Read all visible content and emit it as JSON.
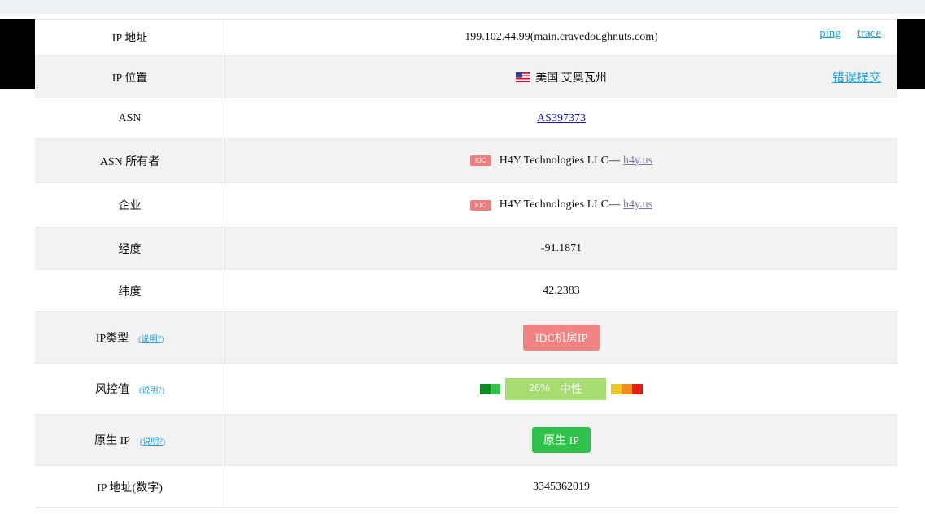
{
  "rows": [
    {
      "label": "IP 地址",
      "value": "199.102.44.99(main.cravedoughnuts.com)",
      "links": [
        "ping",
        "trace"
      ]
    },
    {
      "label": "IP 位置",
      "value": "美国 艾奥瓦州",
      "report": "错误提交"
    },
    {
      "label": "ASN",
      "value": "AS397373"
    },
    {
      "label": "ASN 所有者",
      "badge": "IDC",
      "value": "H4Y Technologies LLC—",
      "domain": "h4y.us"
    },
    {
      "label": "企业",
      "badge": "IDC",
      "value": "H4Y Technologies LLC—",
      "domain": "h4y.us"
    },
    {
      "label": "经度",
      "value": "-91.1871"
    },
    {
      "label": "纬度",
      "value": "42.2383"
    },
    {
      "label": "IP类型",
      "help": "(说明?)",
      "value": "IDC机房IP"
    },
    {
      "label": "风控值",
      "help": "(说明?)",
      "percent": "26%",
      "level": "中性",
      "risk_fraction": 0.26
    },
    {
      "label": "原生 IP",
      "help": "(说明?)",
      "value": "原生 IP"
    },
    {
      "label": "IP 地址(数字)",
      "value": "3345362019"
    }
  ],
  "colors": {
    "link": "#17a3d8",
    "idc_badge": "#ef7f7f",
    "ip_type_badge": "#f18383",
    "risk_neutral": "#a7dc70",
    "native_badge": "#2ec24a"
  },
  "icons": {
    "flag": "us-flag-icon"
  }
}
